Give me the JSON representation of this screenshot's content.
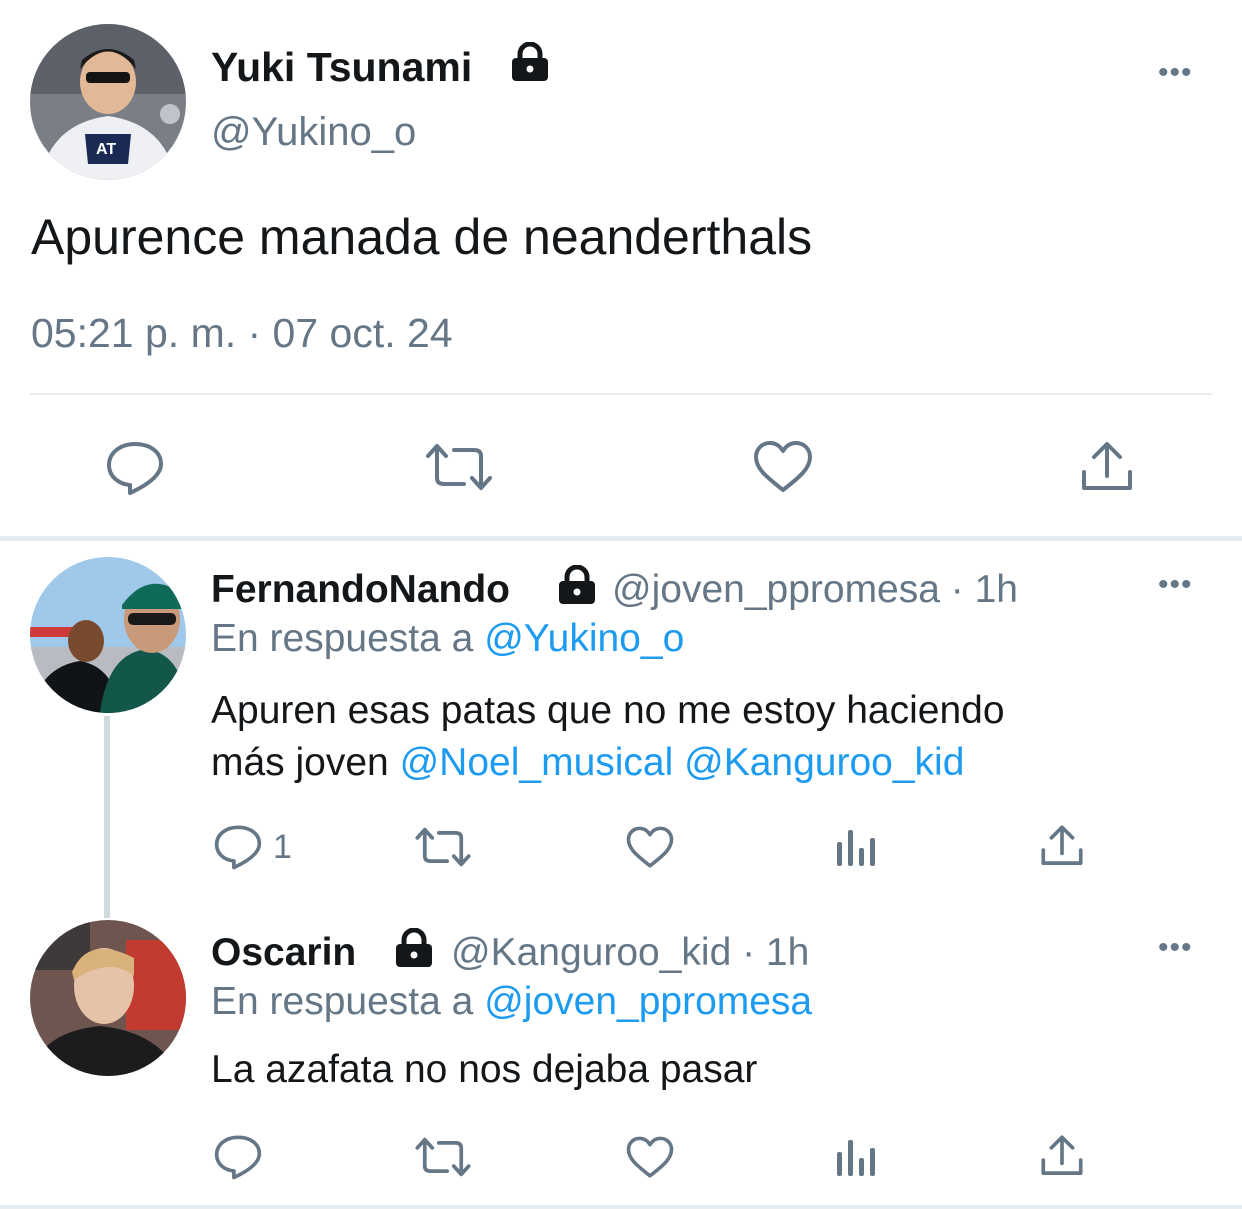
{
  "main_tweet": {
    "display_name": "Yuki Tsunami",
    "handle": "@Yukino_o",
    "text": "Apurence manada de neanderthals",
    "timestamp": "05:21 p. m. · 07 oct. 24",
    "more_label": "•••",
    "protected_icon": "lock-icon",
    "actions": [
      "reply-icon",
      "retweet-icon",
      "like-icon",
      "share-icon"
    ]
  },
  "replies": [
    {
      "display_name": "FernandoNando",
      "meta": "@joven_ppromesa · 1h",
      "reply_prefix": "En respuesta a",
      "reply_to": "@Yukino_o",
      "text_line1": "Apuren esas patas que no me estoy haciendo",
      "text_line2_prefix": "más joven",
      "mention1": "@Noel_musical",
      "mention2": "@Kanguroo_kid",
      "reply_count": "1",
      "more_label": "•••"
    },
    {
      "display_name": "Oscarin",
      "meta": "@Kanguroo_kid · 1h",
      "reply_prefix": "En respuesta a",
      "reply_to": "@joven_ppromesa",
      "text": "La azafata no nos dejaba pasar",
      "more_label": "•••"
    }
  ],
  "colors": {
    "text": "#14171a",
    "secondary": "#657786",
    "link": "#1d9bf0",
    "divider": "#e6ecf0"
  }
}
